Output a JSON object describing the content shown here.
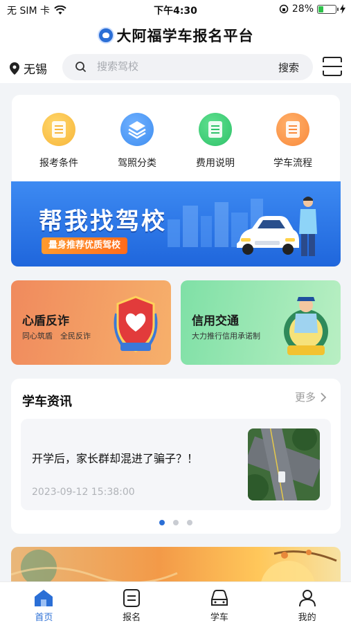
{
  "status_bar": {
    "carrier": "无 SIM 卡",
    "time": "下午4:30",
    "battery_percent": "28%",
    "battery_level": 0.28
  },
  "header": {
    "title": "大阿福学车报名平台",
    "city": "无锡",
    "search_placeholder": "搜索驾校",
    "search_button": "搜索"
  },
  "quick_entries": [
    {
      "label": "报考条件",
      "icon": "document-icon",
      "color": "#f7b63a"
    },
    {
      "label": "驾照分类",
      "icon": "layers-icon",
      "color": "#3f8ef0"
    },
    {
      "label": "费用说明",
      "icon": "receipt-icon",
      "color": "#2fc26a"
    },
    {
      "label": "学车流程",
      "icon": "list-icon",
      "color": "#f98a3c"
    }
  ],
  "banner": {
    "title": "帮我找驾校",
    "subtitle": "量身推荐优质驾校"
  },
  "promos": [
    {
      "title": "心盾反诈",
      "subtitle": "同心筑盾　全民反诈"
    },
    {
      "title": "信用交通",
      "subtitle": "大力推行信用承诺制"
    }
  ],
  "news": {
    "heading": "学车资讯",
    "more_label": "更多",
    "items": [
      {
        "title": "开学后，家长群却混进了骗子？！",
        "date": "2023-09-12 15:38:00"
      }
    ],
    "page_count": 3,
    "active_page": 1
  },
  "tabbar": {
    "tabs": [
      {
        "label": "首页",
        "icon": "home-icon",
        "active": true
      },
      {
        "label": "报名",
        "icon": "signup-icon",
        "active": false
      },
      {
        "label": "学车",
        "icon": "car-icon",
        "active": false
      },
      {
        "label": "我的",
        "icon": "user-icon",
        "active": false
      }
    ]
  },
  "colors": {
    "accent": "#2b6fd6",
    "banner_blue": "#2a73e6",
    "orange": "#ff7a1f"
  }
}
